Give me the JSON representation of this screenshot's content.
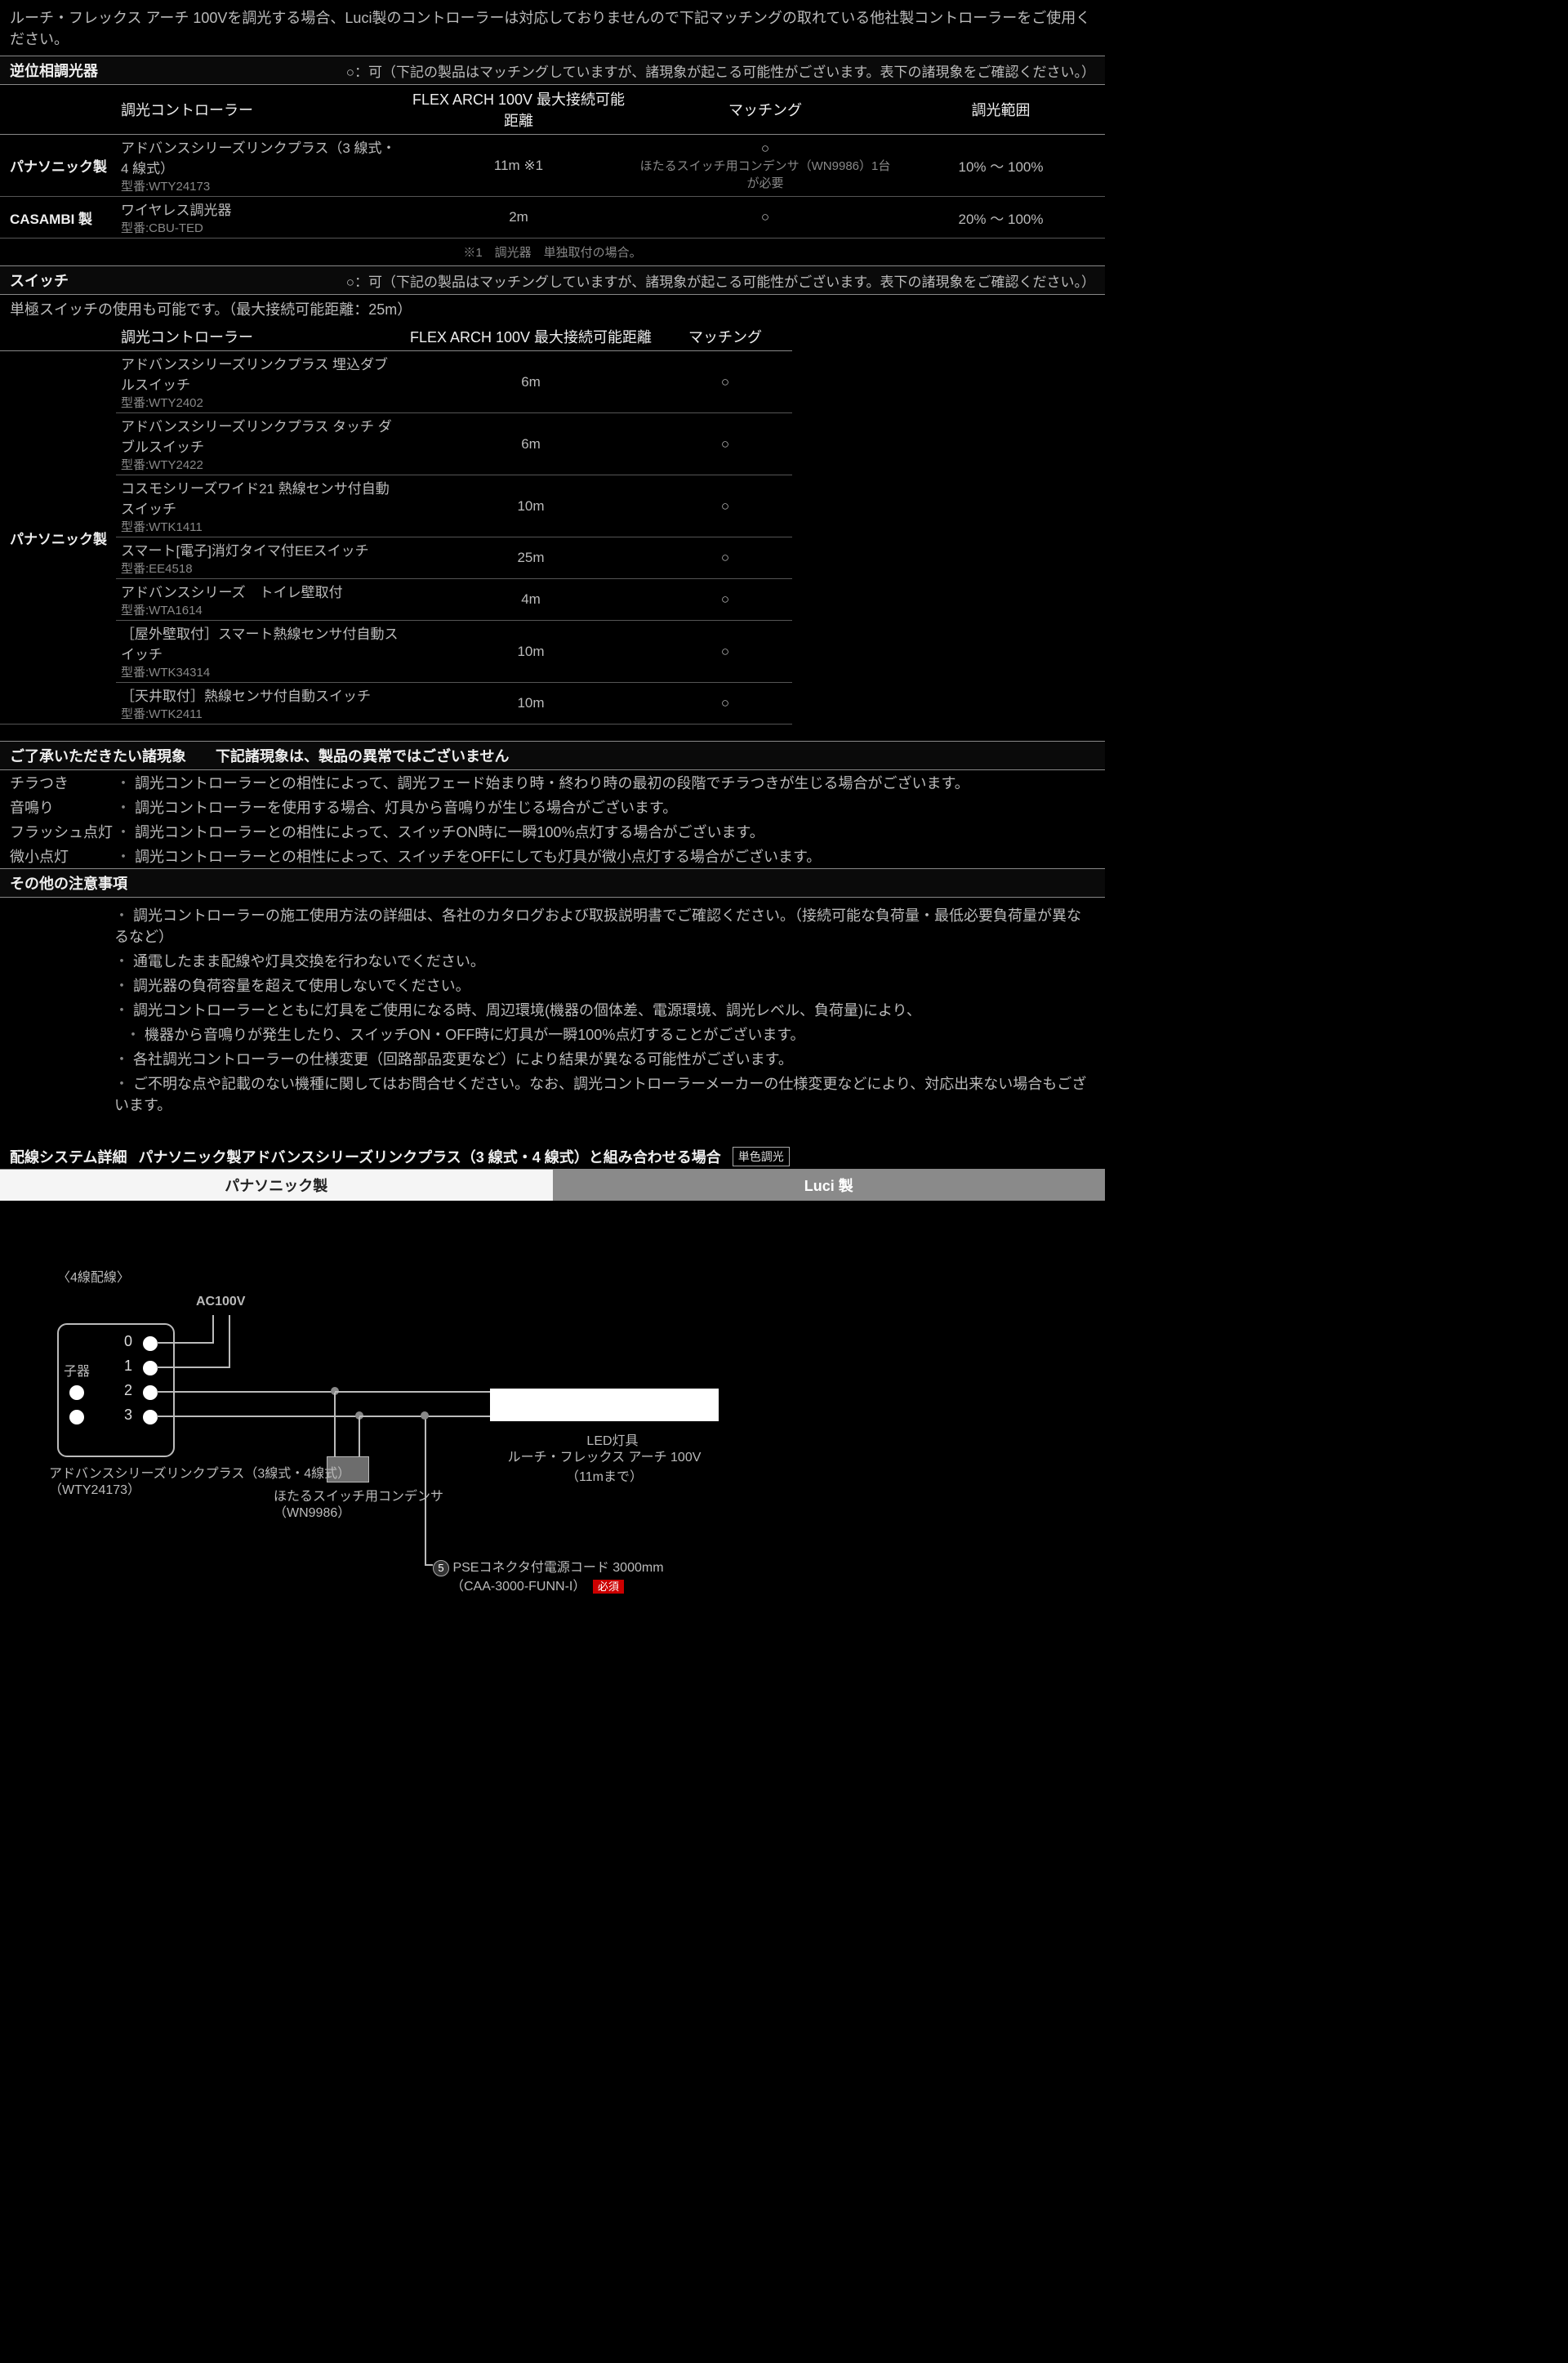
{
  "intro": "ルーチ・フレックス アーチ 100Vを調光する場合、Luci製のコントローラーは対応しておりませんので下記マッチングの取れている他社製コントローラーをご使用ください。",
  "section1": {
    "title": "逆位相調光器",
    "note": "○：可（下記の製品はマッチングしていますが、諸現象が起こる可能性がございます。表下の諸現象をご確認ください。）",
    "headers": [
      "調光コントローラー",
      "FLEX ARCH 100V 最大接続可能距離",
      "マッチング",
      "調光範囲"
    ],
    "rows": [
      {
        "maker": "パナソニック製",
        "ctrl": "アドバンスシリーズリンクプラス（3 線式・4 線式）",
        "model": "型番:WTY24173",
        "dist": "11m ※1",
        "match": "○",
        "matchNote": "ほたるスイッチ用コンデンサ（WN9986）1台が必要",
        "range": "10% ～ 100%"
      },
      {
        "maker": "CASAMBI 製",
        "ctrl": "ワイヤレス調光器",
        "model": "型番:CBU-TED",
        "dist": "2m",
        "match": "○",
        "matchNote": "",
        "range": "20% ～ 100%"
      }
    ],
    "footnote": "※1　調光器　単独取付の場合。"
  },
  "section2": {
    "title": "スイッチ",
    "note": "○：可（下記の製品はマッチングしていますが、諸現象が起こる可能性がございます。表下の諸現象をご確認ください。）",
    "free": "単極スイッチの使用も可能です。（最大接続可能距離：25m）",
    "headers": [
      "調光コントローラー",
      "FLEX ARCH 100V 最大接続可能距離",
      "マッチング"
    ],
    "maker": "パナソニック製",
    "rows": [
      {
        "ctrl": "アドバンスシリーズリンクプラス 埋込ダブルスイッチ",
        "model": "型番:WTY2402",
        "dist": "6m",
        "match": "○"
      },
      {
        "ctrl": "アドバンスシリーズリンクプラス タッチ ダブルスイッチ",
        "model": "型番:WTY2422",
        "dist": "6m",
        "match": "○"
      },
      {
        "ctrl": "コスモシリーズワイド21 熱線センサ付自動スイッチ",
        "model": "型番:WTK1411",
        "dist": "10m",
        "match": "○"
      },
      {
        "ctrl": "スマート[電子]消灯タイマ付EEスイッチ",
        "model": "型番:EE4518",
        "dist": "25m",
        "match": "○"
      },
      {
        "ctrl": "アドバンスシリーズ　トイレ壁取付",
        "model": "型番:WTA1614",
        "dist": "4m",
        "match": "○"
      },
      {
        "ctrl": "［屋外壁取付］スマート熱線センサ付自動スイッチ",
        "model": "型番:WTK34314",
        "dist": "10m",
        "match": "○"
      },
      {
        "ctrl": "［天井取付］熱線センサ付自動スイッチ",
        "model": "型番:WTK2411",
        "dist": "10m",
        "match": "○"
      }
    ]
  },
  "phenomena": {
    "title": "ご了承いただきたい諸現象　　下記諸現象は、製品の異常ではございません",
    "items": [
      {
        "label": "チラつき",
        "text": "調光コントローラーとの相性によって、調光フェード始まり時・終わり時の最初の段階でチラつきが生じる場合がございます。"
      },
      {
        "label": "音鳴り",
        "text": "調光コントローラーを使用する場合、灯具から音鳴りが生じる場合がございます。"
      },
      {
        "label": "フラッシュ点灯",
        "text": "調光コントローラーとの相性によって、スイッチON時に一瞬100%点灯する場合がございます。"
      },
      {
        "label": "微小点灯",
        "text": "調光コントローラーとの相性によって、スイッチをOFFにしても灯具が微小点灯する場合がございます。"
      }
    ]
  },
  "other": {
    "title": "その他の注意事項",
    "bullets": [
      "調光コントローラーの施工使用方法の詳細は、各社のカタログおよび取扱説明書でご確認ください。（接続可能な負荷量・最低必要負荷量が異なるなど）",
      "通電したまま配線や灯具交換を行わないでください。",
      "調光器の負荷容量を超えて使用しないでください。",
      "調光コントローラーとともに灯具をご使用になる時、周辺環境(機器の個体差、電源環境、調光レベル、負荷量)により、",
      "機器から音鳴りが発生したり、スイッチON・OFF時に灯具が一瞬100%点灯することがございます。",
      "各社調光コントローラーの仕様変更（回路部品変更など）により結果が異なる可能性がございます。",
      "ご不明な点や記載のない機種に関してはお問合せください。なお、調光コントローラーメーカーの仕様変更などにより、対応出来ない場合もございます。"
    ]
  },
  "wiring": {
    "titleA": "配線システム詳細",
    "titleB": "パナソニック製アドバンスシリーズリンクプラス（3 線式・4 線式）と組み合わせる場合",
    "tag": "単色調光",
    "leftHeader": "パナソニック製",
    "rightHeader": "Luci 製",
    "wireLabel": "〈4線配線〉",
    "ac": "AC100V",
    "nums": [
      "0",
      "1",
      "2",
      "3"
    ],
    "child": "子器",
    "ctrlName": "アドバンスシリーズリンクプラス（3線式・4線式）",
    "ctrlModel": "（WTY24173）",
    "condName": "ほたるスイッチ用コンデンサ",
    "condModel": "（WN9986）",
    "ledTitle": "LED灯具",
    "ledName": "ルーチ・フレックス アーチ 100V（11mまで）",
    "pseNum": "5",
    "pseText": "PSEコネクタ付電源コード 3000mm",
    "pseModel": "（CAA-3000-FUNN-I）",
    "req": "必須"
  }
}
